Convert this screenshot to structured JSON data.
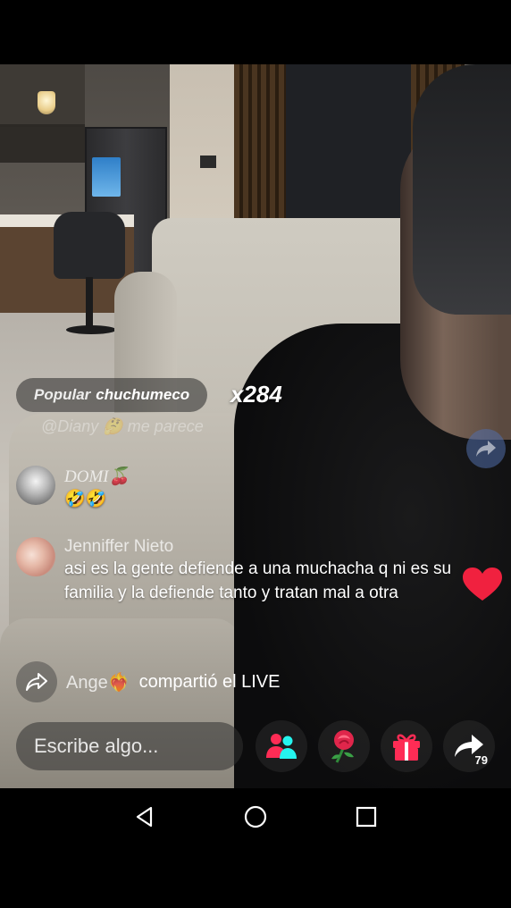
{
  "live": {
    "popular": {
      "label": "Popular",
      "user": "chuchumeco"
    },
    "multiplier": "x284",
    "faded_comment": "@Diany 🤔 me parece",
    "comments": [
      {
        "name": "DOMI🍒",
        "text": "🤣🤣",
        "avatar": "domi-avatar"
      },
      {
        "name": "Jenniffer Nieto",
        "text": "asi es la gente defiende a una muchacha q ni es su familia y la defiende tanto y tratan mal a otra",
        "avatar": "jenniffer-avatar"
      }
    ],
    "share_event": {
      "user": "Ange❤️‍🔥",
      "text": "compartió el LIVE"
    },
    "input": {
      "placeholder": "Escribe algo..."
    },
    "actions": {
      "share_count": "79",
      "icons": [
        "co-host-icon",
        "rose-gift-icon",
        "gift-box-icon",
        "share-arrow-icon"
      ]
    }
  },
  "colors": {
    "accent_pink": "#fe2c55",
    "rose_red": "#e0264b",
    "teal": "#25f4ee",
    "heart_red": "#f0213f"
  },
  "navigation": {
    "icons": [
      "back-triangle-icon",
      "home-circle-icon",
      "recents-square-icon"
    ]
  }
}
